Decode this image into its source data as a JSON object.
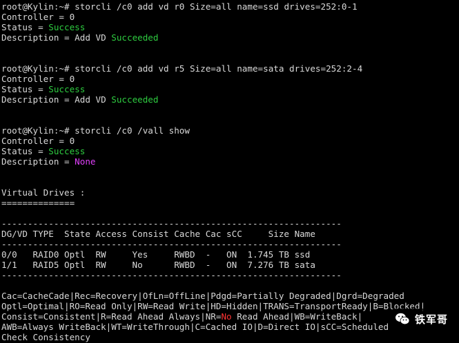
{
  "terminal": {
    "blocks": [
      {
        "prompt": "root@Kylin:~# ",
        "command": "storcli /c0 add vd r0 Size=all name=ssd drives=252:0-1",
        "controller": "Controller = 0",
        "status_key": "Status = ",
        "status_value": "Success",
        "desc_key": "Description = ",
        "desc_prefix": "Add VD ",
        "desc_value": "Succeeded"
      },
      {
        "prompt": "root@Kylin:~# ",
        "command": "storcli /c0 add vd r5 Size=all name=sata drives=252:2-4",
        "controller": "Controller = 0",
        "status_key": "Status = ",
        "status_value": "Success",
        "desc_key": "Description = ",
        "desc_prefix": "Add VD ",
        "desc_value": "Succeeded"
      },
      {
        "prompt": "root@Kylin:~# ",
        "command": "storcli /c0 /vall show",
        "controller": "Controller = 0",
        "status_key": "Status = ",
        "status_value": "Success",
        "desc_key": "Description = ",
        "desc_value": "None"
      }
    ],
    "section_title": "Virtual Drives :",
    "section_underline": "==============",
    "table_rule": "-----------------------------------------------------------------",
    "table_header": "DG/VD TYPE  State Access Consist Cache Cac sCC     Size Name",
    "table_rows": [
      "0/0   RAID0 Optl  RW     Yes     RWBD  -   ON  1.745 TB ssd",
      "1/1   RAID5 Optl  RW     No      RWBD  -   ON  7.276 TB sata"
    ],
    "legend": {
      "line1": "Cac=CacheCade|Rec=Recovery|OfLn=OffLine|Pdgd=Partially Degraded|Dgrd=Degraded",
      "line2": "Optl=Optimal|RO=Read Only|RW=Read Write|HD=Hidden|TRANS=TransportReady|B=Blocked|",
      "line3_before": "Consist=Consistent|R=Read Ahead Always|NR=",
      "line3_red": "No",
      "line3_after": " Read Ahead|WB=WriteBack|",
      "line4": "AWB=Always WriteBack|WT=WriteThrough|C=Cached IO|D=Direct IO|sCC=Scheduled",
      "line5": "Check Consistency"
    }
  },
  "watermark": {
    "text": "铁军哥",
    "icon": "wechat-icon"
  }
}
